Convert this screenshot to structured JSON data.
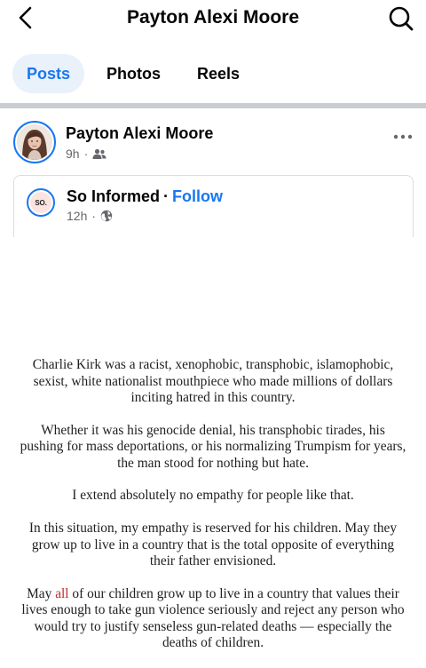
{
  "header": {
    "title": "Payton Alexi Moore",
    "back_icon": "chevron-left-icon",
    "search_icon": "search-icon"
  },
  "tabs": [
    {
      "label": "Posts",
      "active": true
    },
    {
      "label": "Photos",
      "active": false
    },
    {
      "label": "Reels",
      "active": false
    }
  ],
  "post": {
    "author": "Payton Alexi Moore",
    "time": "9h",
    "dot": "·",
    "audience_icon": "friends-icon",
    "more_icon": "more-horizontal-icon"
  },
  "shared": {
    "source_logo_text": "SO.",
    "source_name": "So Informed",
    "separator": "·",
    "follow_label": "Follow",
    "time": "12h",
    "dot": "·",
    "audience_icon": "globe-icon"
  },
  "body": {
    "p1": "Charlie Kirk was a racist, xenophobic, transphobic, islamophobic, sexist, white nationalist mouthpiece who made millions of dollars inciting hatred in this country.",
    "p2": "Whether it was his genocide denial, his transphobic tirades, his pushing for mass deportations, or his normalizing Trumpism for years, the man stood for nothing but hate.",
    "p3": "I extend absolutely no empathy for people like that.",
    "p4": "In this situation, my empathy is reserved for his children. May they grow up to live in a country that is the total opposite of everything their father envisioned.",
    "p5_before": "May ",
    "p5_highlight": "all",
    "p5_after": " of our children grow up to live in a country that values their lives enough to take gun violence seriously and reject any person who would try to justify senseless gun-related deaths — especially the deaths of children."
  },
  "colors": {
    "accent": "#1877f2",
    "active_tab_bg": "#e9f1fb",
    "divider": "#c9ccd1",
    "secondary_text": "#65676b",
    "highlight_red": "#c0282d"
  }
}
